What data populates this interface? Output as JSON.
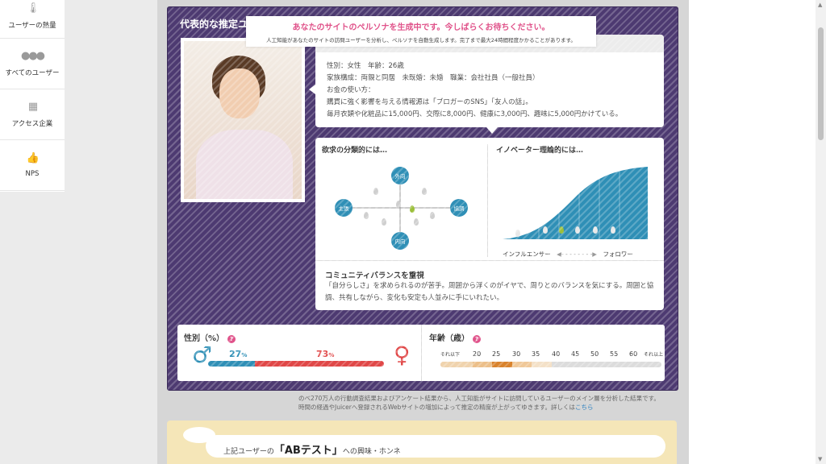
{
  "sidebar": {
    "items": [
      {
        "label": "ユーザーの熱量",
        "icon": "thermometer-icon"
      },
      {
        "label": "すべてのユーザー",
        "icon": "users-icon"
      },
      {
        "label": "アクセス企業",
        "icon": "building-icon"
      },
      {
        "label": "NPS",
        "icon": "thumbs-up-icon"
      }
    ]
  },
  "notice": {
    "title": "あなたのサイトのペルソナを生成中です。今しばらくお待ちください。",
    "message": "人工知能があなたのサイトの訪問ユーザーを分析し、ペルソナを自動生成します。完了まで最大24時間程度かかることがあります。"
  },
  "persona": {
    "title": "代表的な推定ユーザー像",
    "gender_age": "性別：女性　年齢：26歳",
    "family": "家族構成：両親と同居　未既婚：未婚　職業：会社社員（一般社員）",
    "money_label": "お金の使い方：",
    "money_line1": "購買に強く影響を与える情報源は「ブロガーのSNS」「友人の話」。",
    "money_line2": "毎月衣類や化粧品に15,000円、交際に8,000円、健康に3,000円、趣味に5,000円かけている。"
  },
  "desire": {
    "title": "欲求の分類的には…",
    "axis_top": "外向",
    "axis_bottom": "内向",
    "axis_left": "主張",
    "axis_right": "協調"
  },
  "innovator": {
    "title": "イノベーター理論的には…",
    "left_label": "インフルエンサー",
    "right_label": "フォロワー",
    "arrow": "◀- - - - - - - -▶",
    "curve_color": "#2f8fb6"
  },
  "community": {
    "title": "コミュニティバランスを重視",
    "text": "「自分らしさ」を求められるのが苦手。周囲から浮くのがイヤで、周りとのバランスを気にする。周囲と協調、共有しながら、変化も安定も人並みに手にいれたい。"
  },
  "gender_stats": {
    "title": "性別（%）",
    "male_pct": "27",
    "female_pct": "73",
    "unit": "%",
    "male_color": "#2f8fb6",
    "female_color": "#e04747"
  },
  "age_stats": {
    "title": "年齢（歳）",
    "labels": [
      "それ以下",
      "20",
      "25",
      "30",
      "35",
      "40",
      "45",
      "50",
      "55",
      "60",
      "それ以上"
    ]
  },
  "footnote": {
    "line1": "のべ270万人の行動調査結果およびアンケート結果から、人工知能がサイトに訪問しているユーザーのメイン層を分析した結果です。",
    "line2": "時間の経過やJuicerへ登録されるWebサイトの増加によって推定の精度が上がってゆきます。詳しくは",
    "link": "こちら"
  },
  "interest": {
    "prefix": "上記ユーザーの",
    "topic": "「ABテスト」",
    "suffix": "への興味・ホンネ"
  },
  "help_mark": "?"
}
